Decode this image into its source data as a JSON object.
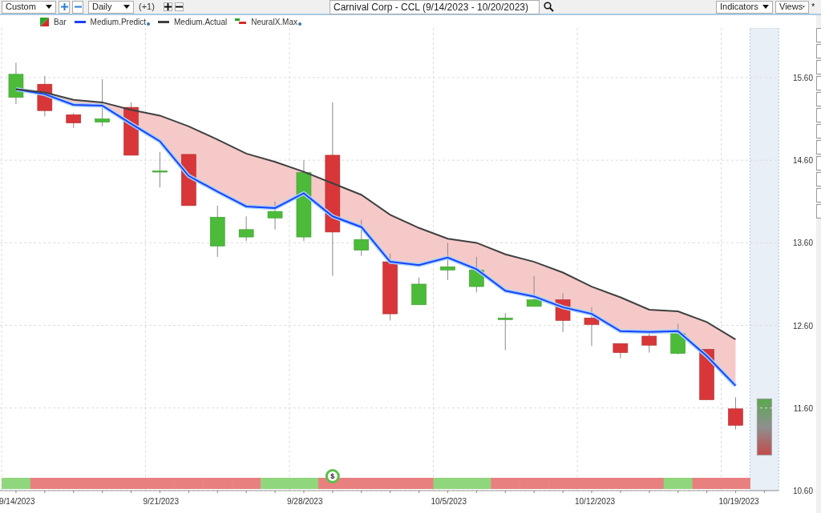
{
  "toolbar": {
    "preset": "Custom",
    "interval": "Daily",
    "offset": "(+1)",
    "symbol_title": "Carnival Corp - CCL (9/14/2023 - 10/20/2023)",
    "indicators": "Indicators",
    "views": "Views",
    "modified_mark": "*"
  },
  "legend": [
    {
      "kind": "bar",
      "label": "Bar",
      "info": false
    },
    {
      "kind": "line",
      "label": "Medium.Predict",
      "color": "#1f3fff",
      "info": true
    },
    {
      "kind": "line",
      "label": "Medium.Actual",
      "color": "#404040",
      "info": false
    },
    {
      "kind": "signal",
      "label": "NeuralX.Max",
      "info": true
    }
  ],
  "chart": {
    "chart_data": {
      "type": "line",
      "categories": [
        "9/14/2023",
        null,
        null,
        null,
        null,
        "9/21/2023",
        null,
        null,
        null,
        null,
        "9/28/2023",
        null,
        null,
        null,
        null,
        "10/5/2023",
        null,
        null,
        null,
        null,
        "10/12/2023",
        null,
        null,
        null,
        null,
        "10/19/2023"
      ],
      "series": [
        {
          "color": "#1f3fff",
          "values": [
            15.46,
            15.4,
            15.27,
            15.26,
            15.04,
            14.83,
            14.41,
            14.22,
            14.04,
            14.02,
            14.2,
            13.92,
            13.79,
            13.37,
            13.33,
            13.42,
            13.28,
            13.02,
            12.95,
            12.82,
            12.74,
            12.53,
            12.52,
            12.53,
            12.23,
            11.87
          ]
        },
        {
          "color": "#404040",
          "values": [
            15.46,
            15.42,
            15.33,
            15.3,
            15.21,
            15.14,
            15.01,
            14.85,
            14.68,
            14.58,
            14.46,
            14.32,
            14.18,
            13.94,
            13.78,
            13.65,
            13.6,
            13.46,
            13.37,
            13.24,
            13.07,
            12.94,
            12.79,
            12.77,
            12.64,
            12.43
          ]
        }
      ],
      "ylim": [
        10.6,
        16.2
      ],
      "grid": true,
      "yticks": [
        {
          "value": 15.6,
          "label": "15.60"
        },
        {
          "value": 14.6,
          "label": "14.60"
        },
        {
          "value": 13.6,
          "label": "13.60"
        },
        {
          "value": 12.6,
          "label": "12.60"
        },
        {
          "value": 11.6,
          "label": "11.60"
        },
        {
          "value": 10.6,
          "label": "10.60"
        }
      ],
      "ylabel": null
    },
    "signal_band": [
      {
        "color": "#90d67c"
      },
      {
        "color": "#e98080"
      },
      {
        "color": "#e98080"
      },
      {
        "color": "#e98080"
      },
      {
        "color": "#e98080"
      },
      {
        "color": "#e98080"
      },
      {
        "color": "#e98080"
      },
      {
        "color": "#e98080"
      },
      {
        "color": "#e98080"
      },
      {
        "color": "#90d67c"
      },
      {
        "color": "#90d67c"
      },
      {
        "color": "#e98080",
        "marker": "$"
      },
      {
        "color": "#e98080"
      },
      {
        "color": "#e98080"
      },
      {
        "color": "#e98080"
      },
      {
        "color": "#90d67c"
      },
      {
        "color": "#90d67c"
      },
      {
        "color": "#e98080"
      },
      {
        "color": "#e98080"
      },
      {
        "color": "#e98080"
      },
      {
        "color": "#e98080"
      },
      {
        "color": "#e98080"
      },
      {
        "color": "#e98080"
      },
      {
        "color": "#90d67c"
      },
      {
        "color": "#e98080"
      },
      {
        "color": "#e98080"
      }
    ]
  }
}
